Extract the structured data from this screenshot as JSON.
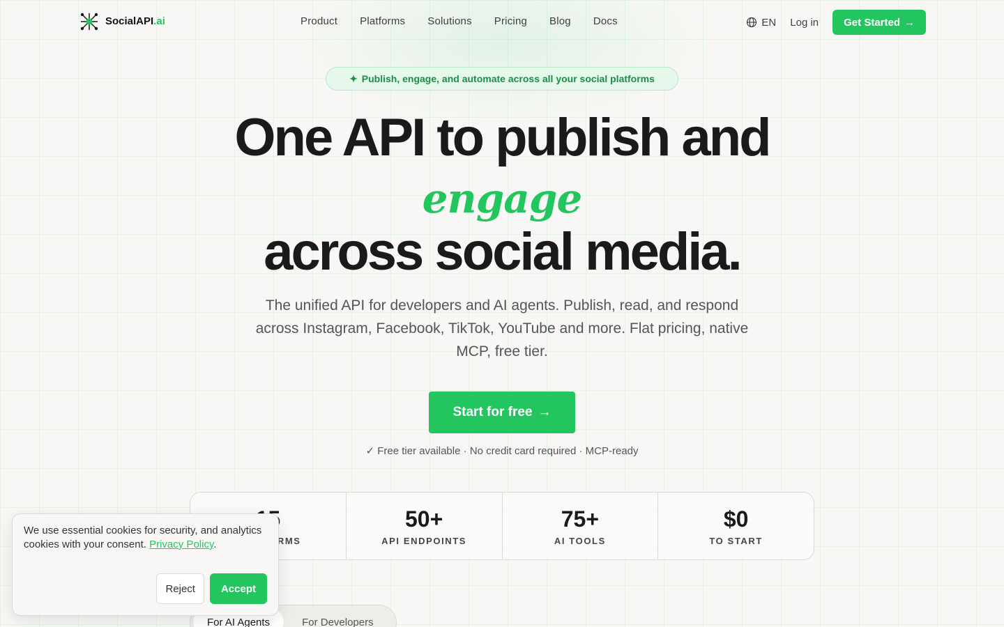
{
  "nav": {
    "logo_main": "SocialAPI",
    "logo_accent": ".ai",
    "links": [
      "Product",
      "Platforms",
      "Solutions",
      "Pricing",
      "Blog",
      "Docs"
    ],
    "lang": "EN",
    "login": "Log in",
    "cta": "Get Started",
    "cta_arrow": "→"
  },
  "hero": {
    "pill_icon": "✦",
    "pill": "Publish, engage, and automate across all your social platforms",
    "title_line1": "One API to publish and",
    "title_script": "engage",
    "title_line3": "across social media.",
    "subtitle": "The unified API for developers and AI agents. Publish, read, and respond across Instagram, Facebook, TikTok, YouTube and more. Flat pricing, native MCP, free tier.",
    "cta": "Start for free",
    "cta_arrow": "→",
    "trust": "✓ Free tier available · No credit card required · MCP-ready"
  },
  "stats": [
    {
      "value": "15",
      "label": "PLATFORMS"
    },
    {
      "value": "50+",
      "label": "API ENDPOINTS"
    },
    {
      "value": "75+",
      "label": "AI TOOLS"
    },
    {
      "value": "$0",
      "label": "TO START"
    }
  ],
  "tabs": [
    "For AI Agents",
    "For Developers"
  ],
  "cookie": {
    "text": "We use essential cookies for security, and analytics cookies with your consent.",
    "link": "Privacy Policy",
    "period": ".",
    "reject": "Reject",
    "accept": "Accept"
  },
  "colors": {
    "accent": "#22c55e",
    "text": "#1a1a1a",
    "background": "#f8f7f5"
  },
  "icons": {
    "logo": "network-hub-icon",
    "lang": "globe-icon"
  }
}
